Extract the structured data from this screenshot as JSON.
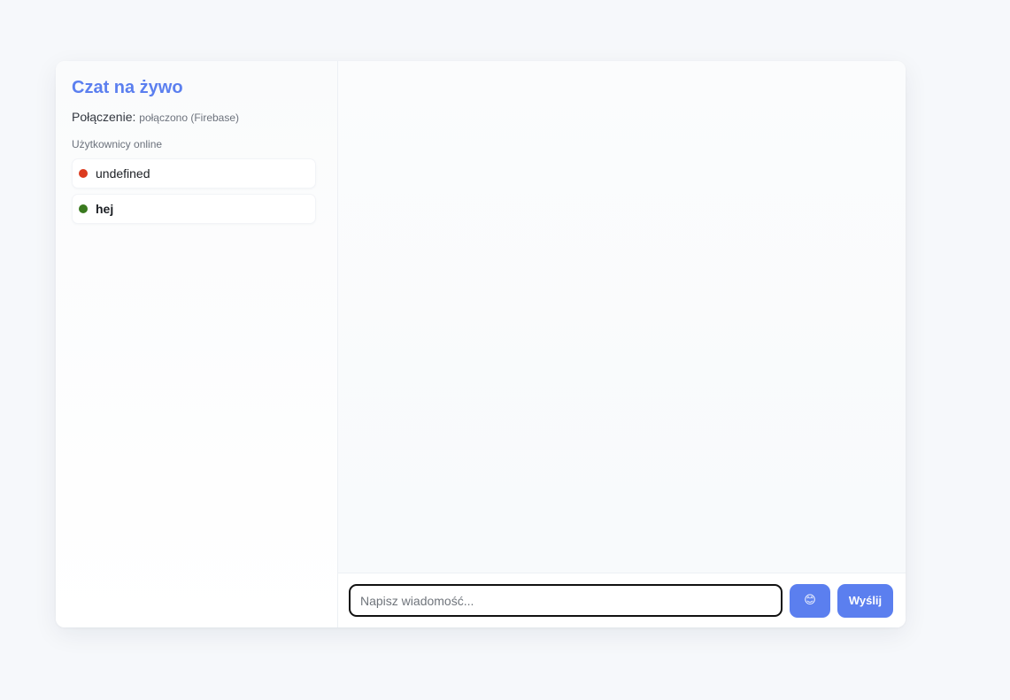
{
  "sidebar": {
    "title": "Czat na żywo",
    "connection_label": "Połączenie:",
    "connection_status": "połączono (Firebase)",
    "users_heading": "Użytkownicy online",
    "users": [
      {
        "name": "undefined",
        "status_color": "#dc3b1f",
        "bold": false
      },
      {
        "name": "hej",
        "status_color": "#3a7a1f",
        "bold": true
      }
    ]
  },
  "composer": {
    "placeholder": "Napisz wiadomość...",
    "value": "",
    "emoji_label": "😊",
    "send_label": "Wyślij"
  },
  "colors": {
    "accent": "#5b7fef",
    "background": "#f6f8fb"
  }
}
